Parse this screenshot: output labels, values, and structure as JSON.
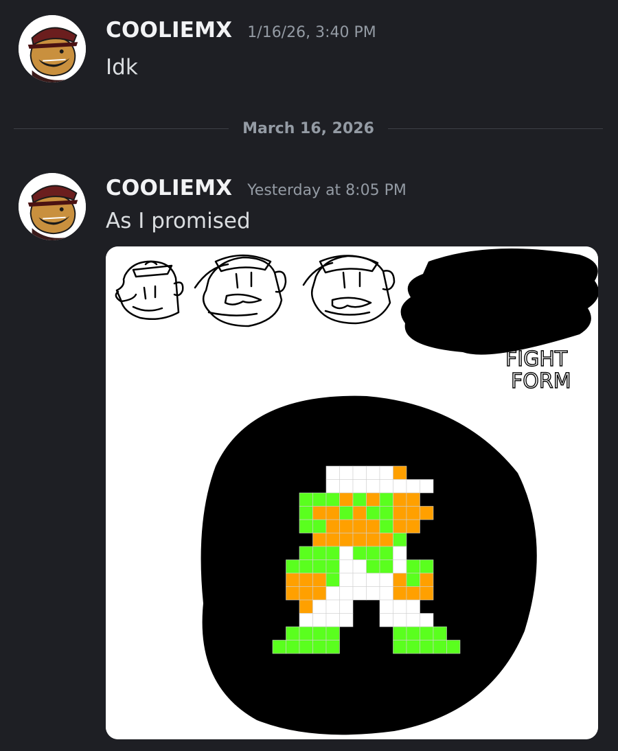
{
  "messages": [
    {
      "author": "COOLIEMX",
      "timestamp": "1/16/26, 3:40 PM",
      "text": "Idk"
    },
    {
      "author": "COOLIEMX",
      "timestamp": "Yesterday at 8:05 PM",
      "text": "As I promised"
    }
  ],
  "date_divider": "March 16, 2026",
  "attachment": {
    "handwritten_text": [
      "FIGHT",
      "FORM"
    ]
  },
  "icons": {
    "avatar": "cartoon-avatar",
    "attachment": "drawing-image"
  },
  "colors": {
    "background": "#1e1f24",
    "username": "#f2f3f5",
    "timestamp": "#949ba4",
    "sprite_green": "#5aff1e",
    "sprite_orange": "#ffa000",
    "sprite_white": "#ffffff"
  }
}
